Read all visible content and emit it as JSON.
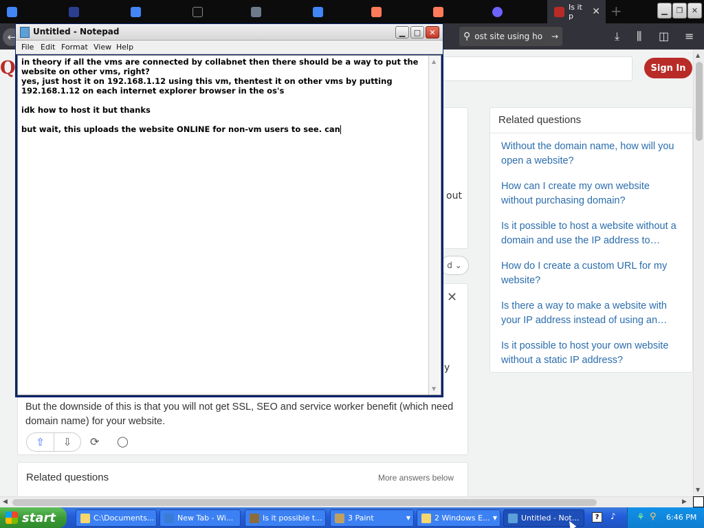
{
  "browser": {
    "tabs": [
      {
        "label": "",
        "favicon_color": "#4285f4"
      },
      {
        "label": "",
        "favicon_color": "#2c3e8f"
      },
      {
        "label": "",
        "favicon_color": "#4285f4"
      },
      {
        "label": "",
        "favicon_color": "#111111"
      },
      {
        "label": "",
        "favicon_color": "#6c7a89"
      },
      {
        "label": "",
        "favicon_color": "#4285f4"
      },
      {
        "label": "",
        "favicon_color": "#ff7a59"
      },
      {
        "label": "",
        "favicon_color": "#ff7a59"
      },
      {
        "label": "",
        "favicon_color": "#6c63ff"
      },
      {
        "label": "Is it p",
        "favicon_color": "#b92b27",
        "active": true
      }
    ],
    "new_tab": "+",
    "url_text": "ost site using ho",
    "back_glyph": "←",
    "go_glyph": "→"
  },
  "page": {
    "logo": "Q",
    "sign_in": "Sign In",
    "fragment_out": "out",
    "fragment_y": "y",
    "sort_label": "d",
    "answer_text": "But the downside of this is that you will not get SSL, SEO and service worker benefit (which need domain name) for your website.",
    "related_bottom_title": "Related questions",
    "more_answers": "More answers below",
    "related_side_title": "Related questions",
    "related_questions": [
      "Without the domain name, how will you open a website?",
      "How can I create my own website without purchasing domain?",
      "Is it possible to host a website without a domain and use the IP address to…",
      "How do I create a custom URL for my website?",
      "Is there a way to make a website with your IP address instead of using an…",
      "Is it possible to host your own website without a static IP address?"
    ]
  },
  "notepad": {
    "title": "Untitled - Notepad",
    "menu": [
      "File",
      "Edit",
      "Format",
      "View",
      "Help"
    ],
    "text": "in theory if all the vms are connected by collabnet then there should be a way to put the website on other vms, right?\nyes, just host it on 192.168.1.12 using this vm, thentest it on other vms by putting 192.168.1.12 on each internet explorer browser in the os's\n\nidk how to host it but thanks\n\nbut wait, this uploads the website ONLINE for non-vm users to see. can"
  },
  "taskbar": {
    "start_label": "start",
    "buttons": [
      {
        "label": "C:\\Documents...",
        "icon_color": "#f5d76e"
      },
      {
        "label": "New Tab - Wi...",
        "icon_color": "#3a7bd5"
      },
      {
        "label": "Is it possible t...",
        "icon_color": "#8a6d3b"
      },
      {
        "label": "3 Paint",
        "icon_color": "#c0a060",
        "group": true
      },
      {
        "label": "2 Windows E...",
        "icon_color": "#f5d76e",
        "group": true
      },
      {
        "label": "Untitled - Not...",
        "icon_color": "#5ba0d8",
        "active": true
      }
    ],
    "clock": "6:46 PM"
  },
  "colors": {
    "quora_red": "#b92b27",
    "link_blue": "#2b6dad",
    "taskbar_blue": "#245edb",
    "start_green": "#3c9a37"
  }
}
